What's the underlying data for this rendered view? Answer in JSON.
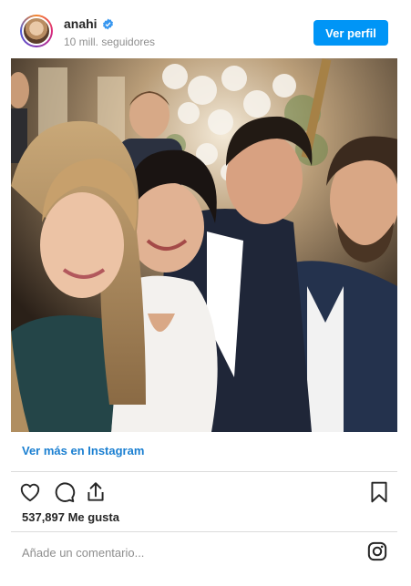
{
  "header": {
    "username": "anahi",
    "followers": "10 mill. seguidores",
    "view_profile_label": "Ver perfil",
    "verified_icon": "verified-badge-icon"
  },
  "photo": {
    "description_icon": "post-photo"
  },
  "links": {
    "view_more": "Ver más en Instagram"
  },
  "actions": {
    "icons": [
      "heart-icon",
      "comment-icon",
      "share-icon",
      "bookmark-icon"
    ]
  },
  "likes": "537,897 Me gusta",
  "comment": {
    "placeholder": "Añade un comentario..."
  },
  "colors": {
    "accent": "#0095f6",
    "link": "#1a7fd1",
    "muted": "#8e8e8e"
  }
}
